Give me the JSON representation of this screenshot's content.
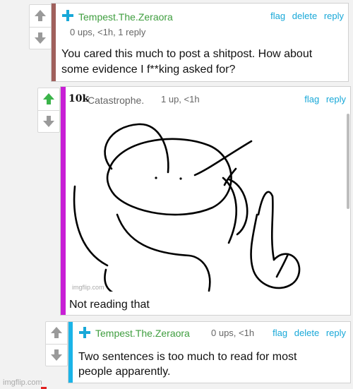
{
  "comment1": {
    "username": "Tempest.The.Zeraora",
    "meta": "0 ups, <1h, 1 reply",
    "actions": [
      "flag",
      "delete",
      "reply"
    ],
    "text_line1": "You cared this much to post a shitpost. How about",
    "text_line2": "some evidence I f**king asked for?"
  },
  "comment2": {
    "badge": "10k",
    "username": "Catastrophe.",
    "meta": "1 up, <1h",
    "actions": [
      "flag",
      "reply"
    ],
    "image_watermark": "imgflip.com",
    "text": "Not reading that"
  },
  "comment3": {
    "username": "Tempest.The.Zeraora",
    "meta": "0 ups, <1h",
    "actions": [
      "flag",
      "delete",
      "reply"
    ],
    "text_line1": "Two sentences is too much to read for most",
    "text_line2": "people apparently."
  },
  "footer": {
    "watermark": "imgflip.com"
  },
  "colors": {
    "bar1": "#a0605c",
    "bar2": "#c81fd6",
    "bar3": "#1ab4e8",
    "link": "#18a8d8",
    "user": "#3f9e3f",
    "upvoted": "#3bb44a"
  }
}
